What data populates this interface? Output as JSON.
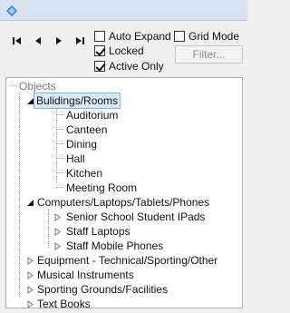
{
  "toolbar": {
    "first_icon": "first-record-icon",
    "prev_icon": "previous-record-icon",
    "next_icon": "next-record-icon",
    "last_icon": "last-record-icon",
    "auto_expand": {
      "label": "Auto Expand",
      "checked": false
    },
    "grid_mode": {
      "label": "Grid Mode",
      "checked": false
    },
    "locked": {
      "label": "Locked",
      "checked": true
    },
    "active_only": {
      "label": "Active Only",
      "checked": true
    },
    "filter_label": "Filter..."
  },
  "tree": {
    "root_label": "Objects",
    "nodes": [
      {
        "label": "Bulidings/Rooms"
      },
      {
        "label": "Auditorium"
      },
      {
        "label": "Canteen"
      },
      {
        "label": "Dining"
      },
      {
        "label": "Hall"
      },
      {
        "label": "Kitchen"
      },
      {
        "label": "Meeting Room"
      },
      {
        "label": "Computers/Laptops/Tablets/Phones"
      },
      {
        "label": "Senior School Student IPads"
      },
      {
        "label": "Staff Laptops"
      },
      {
        "label": "Staff Mobile Phones"
      },
      {
        "label": "Equipment - Technical/Sporting/Other"
      },
      {
        "label": "Musical Instruments"
      },
      {
        "label": "Sporting Grounds/Facilities"
      },
      {
        "label": "Text Books"
      }
    ]
  }
}
